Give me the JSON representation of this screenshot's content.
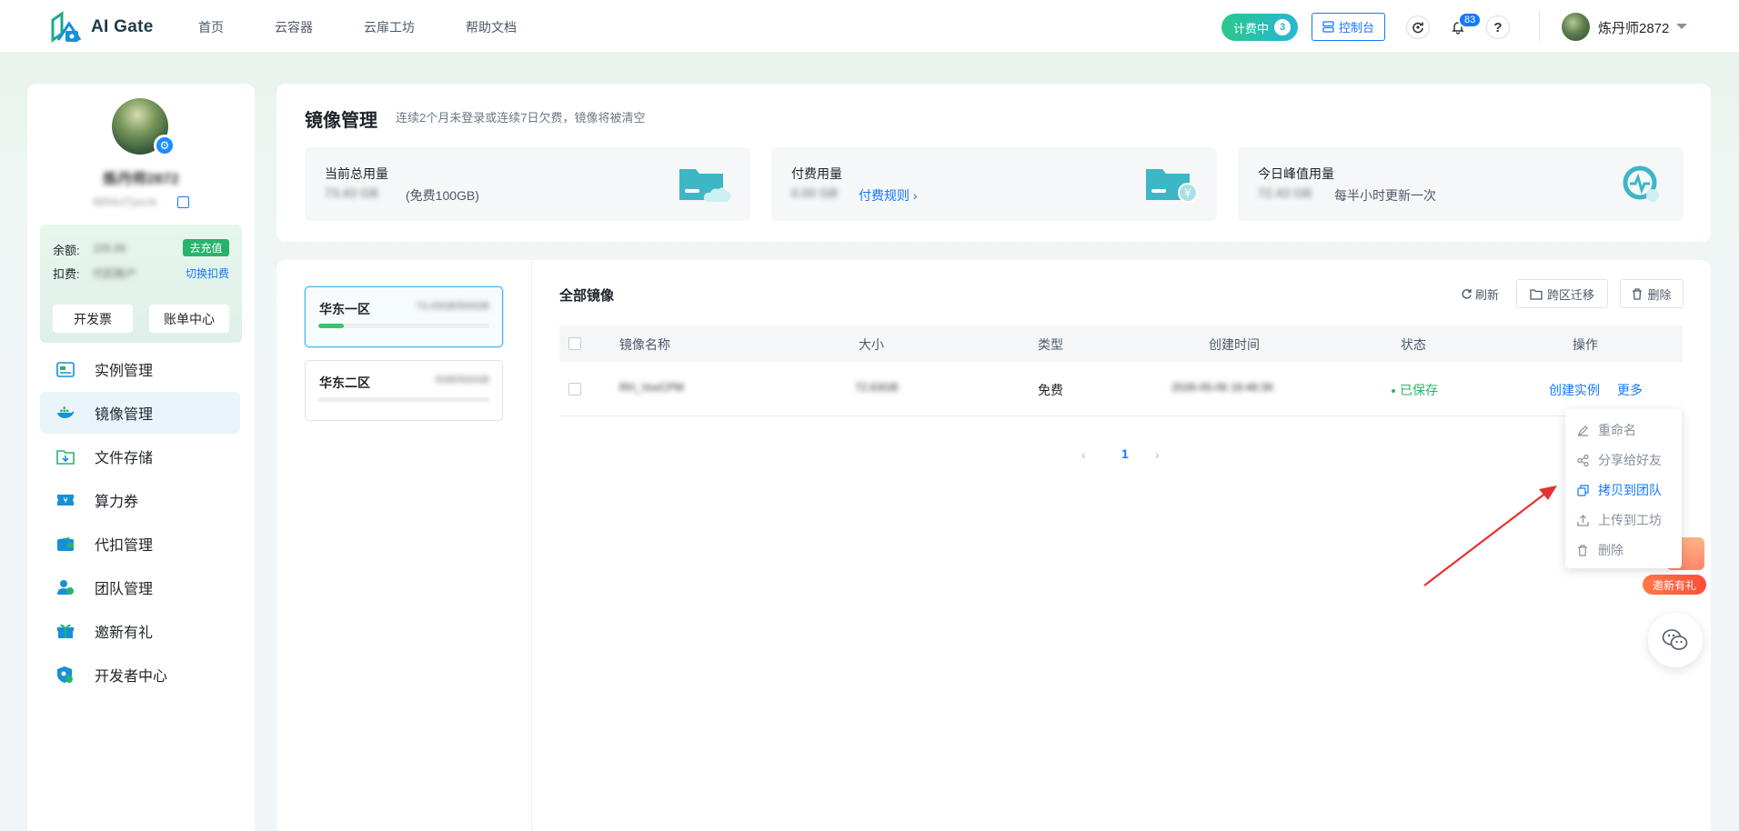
{
  "topbar": {
    "logo_text": "AI Gate",
    "nav": [
      "首页",
      "云容器",
      "云扉工坊",
      "帮助文档"
    ],
    "billing_label": "计费中",
    "billing_count": "3",
    "console_label": "控制台",
    "notification_count": "83",
    "help_glyph": "?",
    "user_name": "炼丹师2872"
  },
  "profile": {
    "name": "炼丹师2872",
    "id": "8894cf7jaxok",
    "balance_label": "余额:",
    "balance_value": "105.66",
    "recharge_label": "去充值",
    "deduct_label": "扣费:",
    "deduct_value": "代扣账户",
    "switch_label": "切换扣费",
    "invoice_label": "开发票",
    "bill_label": "账单中心"
  },
  "sidebar": {
    "items": [
      {
        "label": "实例管理",
        "icon": "instance-icon"
      },
      {
        "label": "镜像管理",
        "icon": "docker-icon"
      },
      {
        "label": "文件存储",
        "icon": "folder-icon"
      },
      {
        "label": "算力券",
        "icon": "coupon-icon"
      },
      {
        "label": "代扣管理",
        "icon": "wallet-icon"
      },
      {
        "label": "团队管理",
        "icon": "team-icon"
      },
      {
        "label": "邀新有礼",
        "icon": "gift-icon"
      },
      {
        "label": "开发者中心",
        "icon": "developer-icon"
      }
    ],
    "active_index": 1
  },
  "summary": {
    "title": "镜像管理",
    "subtitle": "连续2个月未登录或连续7日欠费，镜像将被清空",
    "stats": [
      {
        "label": "当前总用量",
        "value": "73.43 GB",
        "extra": "(免费100GB)"
      },
      {
        "label": "付费用量",
        "value": "0.00 GB",
        "link": "付费规则 ›"
      },
      {
        "label": "今日峰值用量",
        "value": "72.43 GB",
        "extra": "每半小时更新一次"
      }
    ]
  },
  "regions": [
    {
      "name": "华东一区",
      "size": "73.43GB/500GB",
      "usage": 0.15
    },
    {
      "name": "华东二区",
      "size": "0GB/500GB",
      "usage": 0.0
    }
  ],
  "images": {
    "title": "全部镜像",
    "refresh_label": "刷新",
    "migrate_label": "跨区迁移",
    "delete_label": "删除",
    "columns": [
      "镜像名称",
      "大小",
      "类型",
      "创建时间",
      "状态",
      "操作"
    ],
    "rows": [
      {
        "name": "RH_VoxCPM",
        "size": "72.63GB",
        "type": "免费",
        "created": "2026-05-06 16:48:39",
        "status": "已保存",
        "action_create": "创建实例",
        "action_more": "更多"
      }
    ],
    "page": "1"
  },
  "dropdown": {
    "items": [
      "重命名",
      "分享给好友",
      "拷贝到团队",
      "上传到工坊",
      "删除"
    ],
    "highlighted_index": 2
  },
  "floating": {
    "invite_label": "邀新有礼"
  },
  "colors": {
    "accent": "#1677ff",
    "success": "#27b36b",
    "annotation_arrow": "#e5322d"
  }
}
